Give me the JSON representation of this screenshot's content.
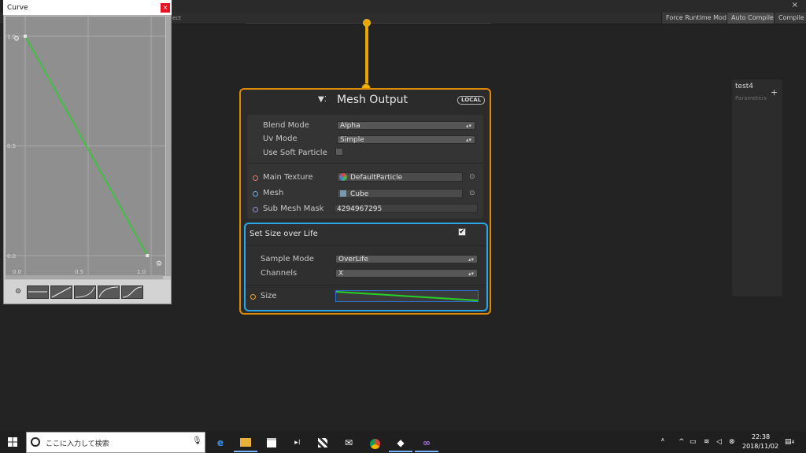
{
  "toolbar": {
    "left_fragment": "ect",
    "buttons": [
      "Force Runtime Mode",
      "Auto Compile",
      "Compile"
    ],
    "close": "×"
  },
  "node": {
    "icon": "vfx-output-icon",
    "title": "Mesh Output",
    "badge": "LOCAL",
    "settings": [
      {
        "label": "Blend Mode",
        "value": "Alpha"
      },
      {
        "label": "Uv Mode",
        "value": "Simple"
      },
      {
        "label": "Use Soft Particle",
        "checked": false
      }
    ],
    "inputs": [
      {
        "label": "Main Texture",
        "value": "DefaultParticle",
        "slot_color": "#e07a6a"
      },
      {
        "label": "Mesh",
        "value": "Cube",
        "slot_color": "#6aa8e0"
      },
      {
        "label": "Sub Mesh Mask",
        "value": "4294967295",
        "slot_color": "#9a8fe0"
      }
    ],
    "target_glyph": "⊙"
  },
  "block": {
    "title": "Set Size over Life",
    "enabled": true,
    "check_glyph": "✔",
    "settings": [
      {
        "label": "Sample Mode",
        "value": "OverLife"
      },
      {
        "label": "Channels",
        "value": "X"
      }
    ],
    "input": {
      "label": "Size",
      "slot_color": "#f0a030"
    },
    "curve_preview": {
      "start": 1.0,
      "end": 0.1
    }
  },
  "blackboard": {
    "title": "test4",
    "subtitle": "Parameters",
    "add": "+"
  },
  "curve_window": {
    "title": "Curve",
    "close": "×",
    "y_ticks": [
      "1.0",
      "0.5",
      "0.0"
    ],
    "x_ticks": [
      "0.0",
      "0.5",
      "1.0"
    ],
    "curve": {
      "points": [
        [
          0.0,
          1.0
        ],
        [
          0.97,
          0.0
        ]
      ],
      "color": "#27d127"
    },
    "presets": [
      "constant",
      "linear",
      "ease-in",
      "ease-out",
      "ease-in-out"
    ]
  },
  "taskbar": {
    "search_placeholder": "ここに入力して検索",
    "time": "22:38",
    "date": "2018/11/02",
    "notification_count": "4",
    "apps": [
      "edge-icon",
      "file-explorer-icon",
      "store-icon",
      "media-icon",
      "app-icon",
      "mail-icon",
      "chrome-icon",
      "unity-icon",
      "visual-studio-icon"
    ]
  },
  "colors": {
    "node_border": "#e08a00",
    "block_border": "#2aa7e6",
    "wire": "#e8a700",
    "curve_green": "#27d127"
  }
}
